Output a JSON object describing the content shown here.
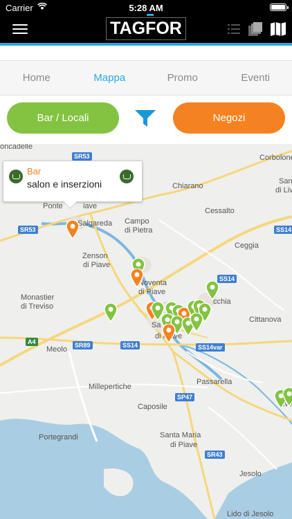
{
  "status": {
    "carrier": "Carrier",
    "time": "5:28 AM"
  },
  "header": {
    "logo_part1": "TAG",
    "logo_part2": "FOR",
    "icons": [
      "menu-icon",
      "list-icon",
      "layers-icon",
      "map-icon"
    ]
  },
  "tabs": [
    {
      "label": "Home",
      "active": false
    },
    {
      "label": "Mappa",
      "active": true
    },
    {
      "label": "Promo",
      "active": false
    },
    {
      "label": "Eventi",
      "active": false
    }
  ],
  "filters": {
    "left_label": "Bar / Locali",
    "right_label": "Negozi",
    "left_color": "#83c341",
    "right_color": "#f58220",
    "filter_icon": "funnel-icon",
    "filter_color": "#1a98d5"
  },
  "popup": {
    "category": "Bar",
    "title": "salon e inserzioni",
    "icon": "bar-cup-icon"
  },
  "map": {
    "places": [
      "oncadelle",
      "Corbolone",
      "San",
      "di Liv",
      "Chiarano",
      "Ponte",
      "iave",
      "Salgareda",
      "Campo",
      "di Pietra",
      "Cessalto",
      "Ceggia",
      "Zenson",
      "di Piave",
      "Noventa",
      "di Piave",
      "Monastier",
      "di Treviso",
      "Cittanova",
      "Meolo",
      "Sa",
      "di Piave",
      "Passarella",
      "Millepertiche",
      "Caposile",
      "Portegrandi",
      "Santa Maria",
      "di Piave",
      "Jesolo",
      "Lido di Jesolo",
      "cchia",
      "ave"
    ],
    "road_labels": [
      "SR53",
      "SR53",
      "SS14",
      "SS14",
      "A4",
      "SR89",
      "SS14",
      "SS14var",
      "SP47",
      "SR43"
    ],
    "colors": {
      "green_pin": "#83c341",
      "orange_pin": "#f58220",
      "water": "#a9cde3",
      "road": "#f5d77c"
    }
  }
}
